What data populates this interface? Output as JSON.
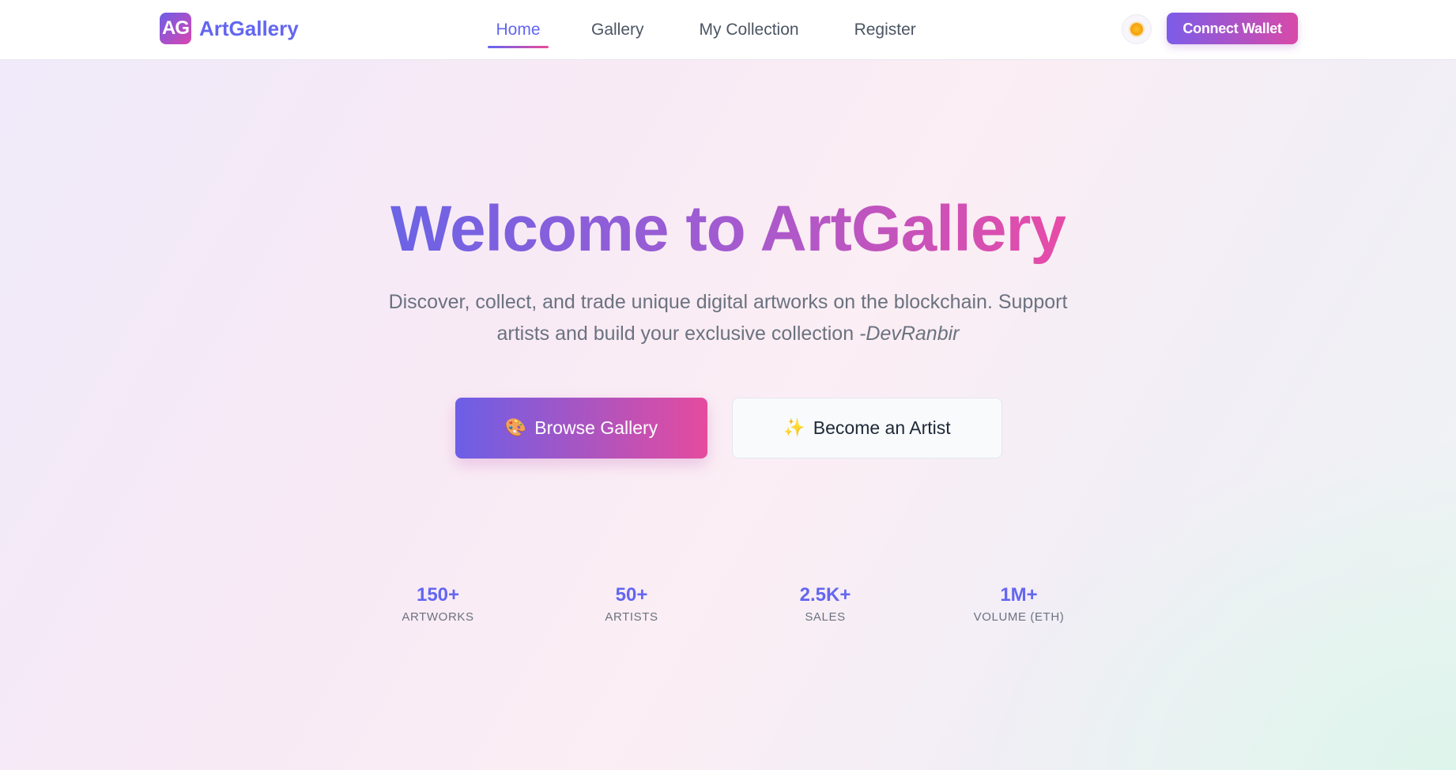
{
  "navbar": {
    "logo_text": "AG",
    "brand": "ArtGallery",
    "links": [
      {
        "label": "Home",
        "active": true
      },
      {
        "label": "Gallery",
        "active": false
      },
      {
        "label": "My Collection",
        "active": false
      },
      {
        "label": "Register",
        "active": false
      }
    ],
    "theme_icon": "sun-icon",
    "connect_label": "Connect Wallet"
  },
  "hero": {
    "title": "Welcome to ArtGallery",
    "subtitle_line1": "Discover, collect, and trade unique digital artworks on the blockchain. Support",
    "subtitle_line2": "artists and build your exclusive collection ",
    "subtitle_author": "-DevRanbir",
    "primary_button": {
      "icon": "🎨",
      "label": "Browse Gallery"
    },
    "secondary_button": {
      "icon": "✨",
      "label": "Become an Artist"
    }
  },
  "stats": [
    {
      "value": "150+",
      "label": "ARTWORKS"
    },
    {
      "value": "50+",
      "label": "ARTISTS"
    },
    {
      "value": "2.5K+",
      "label": "SALES"
    },
    {
      "value": "1M+",
      "label": "VOLUME (ETH)"
    }
  ],
  "colors": {
    "accent": "#6366f1",
    "accent_pink": "#ec4899",
    "text_muted": "#6b7280"
  }
}
